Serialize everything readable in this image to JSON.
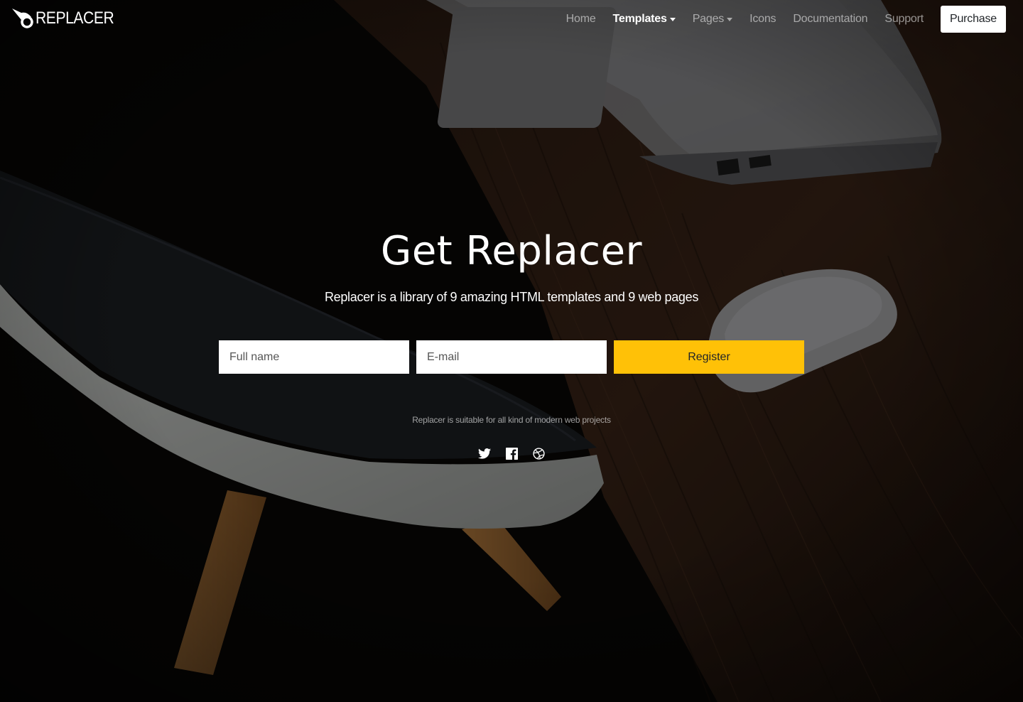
{
  "brand": {
    "name": "REPLACER"
  },
  "nav": {
    "items": [
      {
        "label": "Home",
        "active": false,
        "dropdown": false
      },
      {
        "label": "Templates",
        "active": true,
        "dropdown": true
      },
      {
        "label": "Pages",
        "active": false,
        "dropdown": true
      },
      {
        "label": "Icons",
        "active": false,
        "dropdown": false
      },
      {
        "label": "Documentation",
        "active": false,
        "dropdown": false
      },
      {
        "label": "Support",
        "active": false,
        "dropdown": false
      }
    ],
    "purchase_label": "Purchase"
  },
  "hero": {
    "title": "Get Replacer",
    "subtitle": "Replacer is a library of 9 amazing HTML templates and 9 web pages"
  },
  "form": {
    "name_placeholder": "Full name",
    "email_placeholder": "E-mail",
    "register_label": "Register"
  },
  "footnote": "Replacer is suitable for all kind of modern web projects",
  "socials": [
    {
      "icon": "twitter-icon"
    },
    {
      "icon": "facebook-icon"
    },
    {
      "icon": "dribbble-icon"
    }
  ],
  "colors": {
    "accent": "#ffc107",
    "background": "#0b0806",
    "wood": "#3a2418"
  }
}
